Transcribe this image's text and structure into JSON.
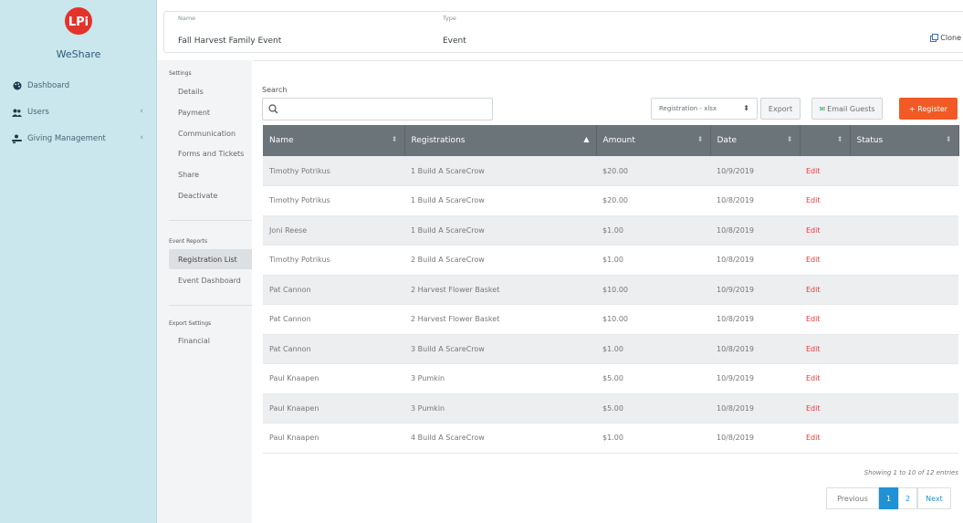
{
  "sidebar": {
    "brand": "WeShare",
    "items": [
      {
        "label": "Dashboard",
        "icon": "palette-icon"
      },
      {
        "label": "Users",
        "icon": "users-icon"
      },
      {
        "label": "Giving Management",
        "icon": "donate-icon"
      }
    ]
  },
  "header": {
    "name_label": "Name",
    "name_value": "Fall Harvest Family Event",
    "type_label": "Type",
    "type_value": "Event",
    "clone": "Clone"
  },
  "settings": {
    "title": "Settings",
    "items": [
      "Details",
      "Payment",
      "Communication",
      "Forms and Tickets",
      "Share",
      "Deactivate"
    ],
    "reports_title": "Event Reports",
    "reports": [
      "Registration List",
      "Event Dashboard"
    ],
    "export_title": "Export Settings",
    "export_items": [
      "Financial"
    ]
  },
  "toolbar": {
    "search_label": "Search",
    "search_value": "",
    "format_select": "Registration - xlsx",
    "export": "Export",
    "email": "Email Guests",
    "register": "+ Register"
  },
  "table": {
    "columns": [
      "Name",
      "Registrations",
      "Amount",
      "Date",
      "",
      "Status"
    ],
    "rows": [
      {
        "name": "Timothy Potrikus",
        "registrations": "1 Build A ScareCrow",
        "amount": "$20.00",
        "date": "10/9/2019",
        "action": "Edit",
        "status": ""
      },
      {
        "name": "Timothy Potrikus",
        "registrations": "1 Build A ScareCrow",
        "amount": "$20.00",
        "date": "10/8/2019",
        "action": "Edit",
        "status": ""
      },
      {
        "name": "Joni Reese",
        "registrations": "1 Build A ScareCrow",
        "amount": "$1.00",
        "date": "10/8/2019",
        "action": "Edit",
        "status": ""
      },
      {
        "name": "Timothy Potrikus",
        "registrations": "2 Build A ScareCrow",
        "amount": "$1.00",
        "date": "10/8/2019",
        "action": "Edit",
        "status": ""
      },
      {
        "name": "Pat Cannon",
        "registrations": "2 Harvest Flower Basket",
        "amount": "$10.00",
        "date": "10/9/2019",
        "action": "Edit",
        "status": ""
      },
      {
        "name": "Pat Cannon",
        "registrations": "2 Harvest Flower Basket",
        "amount": "$10.00",
        "date": "10/8/2019",
        "action": "Edit",
        "status": ""
      },
      {
        "name": "Pat Cannon",
        "registrations": "3 Build A ScareCrow",
        "amount": "$1.00",
        "date": "10/8/2019",
        "action": "Edit",
        "status": ""
      },
      {
        "name": "Paul Knaapen",
        "registrations": "3 Pumkin",
        "amount": "$5.00",
        "date": "10/9/2019",
        "action": "Edit",
        "status": ""
      },
      {
        "name": "Paul Knaapen",
        "registrations": "3 Pumkin",
        "amount": "$5.00",
        "date": "10/8/2019",
        "action": "Edit",
        "status": ""
      },
      {
        "name": "Paul Knaapen",
        "registrations": "4 Build A ScareCrow",
        "amount": "$1.00",
        "date": "10/8/2019",
        "action": "Edit",
        "status": ""
      }
    ]
  },
  "pagination": {
    "showing": "Showing 1 to 10 of 12 entries",
    "previous": "Previous",
    "pages": [
      "1",
      "2"
    ],
    "next": "Next"
  },
  "colors": {
    "sidebar_bg": "#c9e7ec",
    "accent_orange": "#f15a24",
    "edit_red": "#e83a3a",
    "page_active": "#1f91d6",
    "table_header": "#6b7478"
  }
}
